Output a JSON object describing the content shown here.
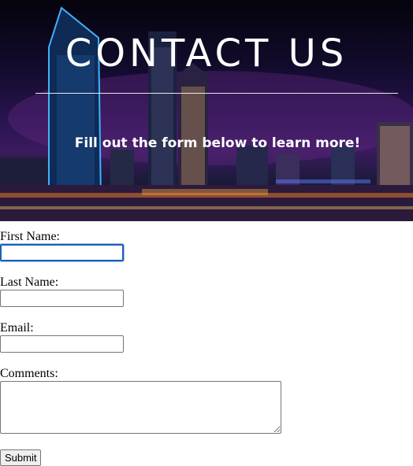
{
  "banner": {
    "title": "CONTACT US",
    "subtitle": "Fill out the form below to learn more!"
  },
  "form": {
    "first_name": {
      "label": "First Name:",
      "value": "",
      "focused": true
    },
    "last_name": {
      "label": "Last Name:",
      "value": ""
    },
    "email": {
      "label": "Email:",
      "value": ""
    },
    "comments": {
      "label": "Comments:",
      "value": ""
    },
    "submit_label": "Submit"
  },
  "colors": {
    "focus_ring": "#1a5fb4",
    "banner_sky": "#2a1450"
  }
}
